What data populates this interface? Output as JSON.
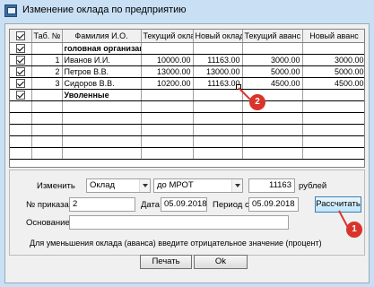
{
  "window": {
    "title": "Изменение оклада по предприятию"
  },
  "grid": {
    "columns": [
      "",
      "Таб. №",
      "Фамилия И.О.",
      "Текущий оклад",
      "Новый оклад",
      "Текущий аванс",
      "Новый аванс"
    ],
    "header_checked": true,
    "rows": [
      {
        "checked": true,
        "tab": "",
        "name": "головная организаци",
        "cur_salary": "",
        "new_salary": "",
        "cur_adv": "",
        "new_adv": "",
        "bold": true
      },
      {
        "checked": true,
        "tab": "1",
        "name": "Иванов И.И.",
        "cur_salary": "10000.00",
        "new_salary": "11163.00",
        "cur_adv": "3000.00",
        "new_adv": "3000.00",
        "bold": false
      },
      {
        "checked": true,
        "tab": "2",
        "name": "Петров В.В.",
        "cur_salary": "13000.00",
        "new_salary": "13000.00",
        "cur_adv": "5000.00",
        "new_adv": "5000.00",
        "bold": false
      },
      {
        "checked": true,
        "tab": "3",
        "name": "Сидоров В.В.",
        "cur_salary": "10200.00",
        "new_salary": "11163.00",
        "cur_adv": "4500.00",
        "new_adv": "4500.00",
        "bold": false
      },
      {
        "checked": true,
        "tab": "",
        "name": "Уволенные",
        "cur_salary": "",
        "new_salary": "",
        "cur_adv": "",
        "new_adv": "",
        "bold": true
      }
    ]
  },
  "form": {
    "change_label": "Изменить",
    "change_value": "Оклад",
    "mode_value": "до МРОТ",
    "amount_value": "11163",
    "amount_unit": "рублей",
    "order_label": "№ приказа",
    "order_value": "2",
    "date_label": "Дата",
    "date_value": "05.09.2018",
    "period_label": "Период с",
    "period_value": "05.09.2018",
    "calc_button": "Рассчитать",
    "basis_label": "Основание",
    "basis_value": ""
  },
  "hint": "Для уменьшения оклада (аванса) введите отрицательное значение (процент)",
  "buttons": {
    "print": "Печать",
    "ok": "Ok"
  },
  "annotations": {
    "badge1": "1",
    "badge2": "2",
    "accent": "#d9342b"
  }
}
